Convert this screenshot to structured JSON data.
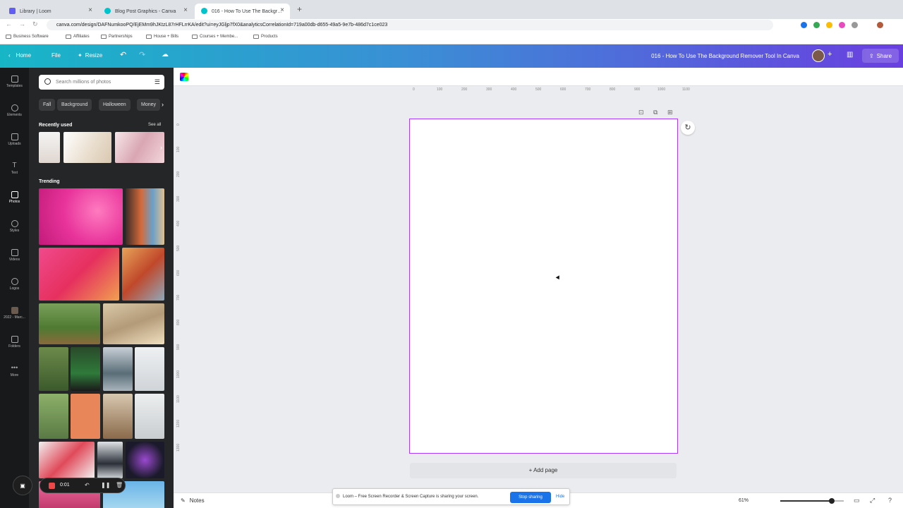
{
  "browser": {
    "tabs": [
      {
        "label": "Library | Loom",
        "color": "#625df5",
        "active": false
      },
      {
        "label": "Blog Post Graphics - Canva",
        "color": "#00c4cc",
        "active": false
      },
      {
        "label": "016 - How To Use The Backgr…",
        "color": "#00c4cc",
        "active": true
      }
    ],
    "url": "canva.com/design/DAFNumkooPQ/EjEMm9hJKtzL87rHFLrrKA/edit?ui=eyJGljp7fX0&analyticsCorrelationId=719a00db-d655-49a5-9e7b-486d7c1ce023",
    "bookmarks": [
      "Business Software",
      "Affiliates",
      "Partnerships",
      "House + Bills",
      "Courses + Membe...",
      "Products"
    ]
  },
  "topbar": {
    "home": "Home",
    "file": "File",
    "resize": "Resize",
    "doc_title": "016 - How To Use The Background Remover Tool In Canva",
    "share": "Share"
  },
  "rail": [
    "Templates",
    "Elements",
    "Uploads",
    "Text",
    "Photos",
    "Styles",
    "Videos",
    "Logos",
    "2022 - Marc...",
    "Folders",
    "More"
  ],
  "panel": {
    "search_placeholder": "Search millions of photos",
    "chips": [
      "Fall",
      "Background",
      "Halloween",
      "Money"
    ],
    "recently_used": "Recently used",
    "see_all": "See all",
    "trending": "Trending"
  },
  "ruler": {
    "h_ticks": [
      "0",
      "100",
      "200",
      "300",
      "400",
      "500",
      "600",
      "700",
      "800",
      "900",
      "1000",
      "1100"
    ],
    "v_ticks": [
      "0",
      "100",
      "200",
      "300",
      "400",
      "500",
      "600",
      "700",
      "800",
      "900",
      "1000",
      "1100",
      "1200",
      "1300"
    ]
  },
  "editor": {
    "add_page": "+ Add page",
    "notes": "Notes",
    "zoom": "61%",
    "zoom_fraction": 0.61
  },
  "loom": {
    "message": "Loom – Free Screen Recorder & Screen Capture is sharing your screen.",
    "stop": "Stop sharing",
    "hide": "Hide",
    "time": "0:01"
  },
  "colors": {
    "accent_page_border": "#a83cff",
    "topbar_start": "#17b6c7",
    "topbar_end": "#6a3fe0"
  }
}
